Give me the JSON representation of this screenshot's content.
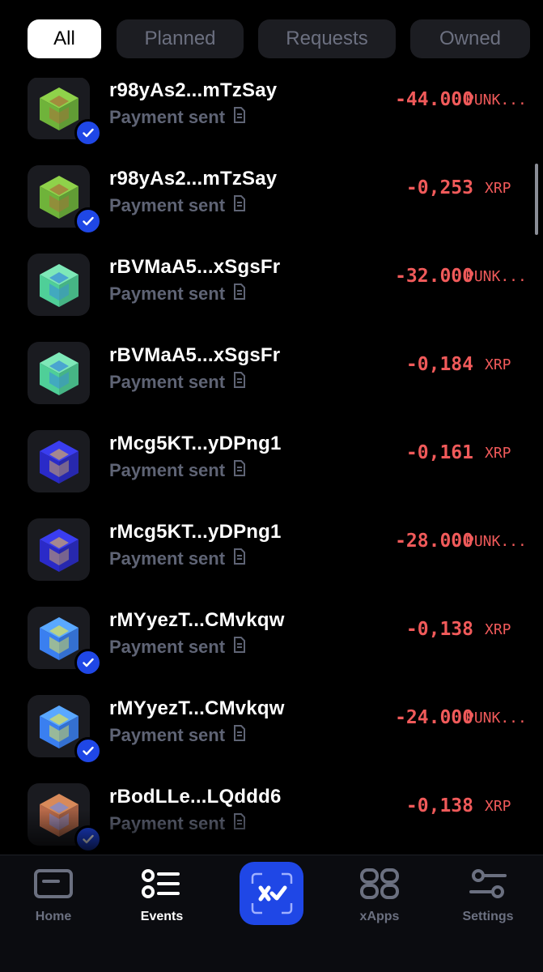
{
  "tabs": [
    {
      "label": "All",
      "active": true
    },
    {
      "label": "Planned",
      "active": false
    },
    {
      "label": "Requests",
      "active": false
    },
    {
      "label": "Owned",
      "active": false
    }
  ],
  "events": [
    {
      "address": "r98yAs2...mTzSay",
      "status": "Payment sent",
      "amount": "-44.000",
      "currency": "PUNK...",
      "verified": true,
      "avatar": "green-cube"
    },
    {
      "address": "r98yAs2...mTzSay",
      "status": "Payment sent",
      "amount": "-0,253",
      "currency": "XRP",
      "verified": true,
      "avatar": "green-cube"
    },
    {
      "address": "rBVMaA5...xSgsFr",
      "status": "Payment sent",
      "amount": "-32.000",
      "currency": "PUNK...",
      "verified": false,
      "avatar": "mint-cube"
    },
    {
      "address": "rBVMaA5...xSgsFr",
      "status": "Payment sent",
      "amount": "-0,184",
      "currency": "XRP",
      "verified": false,
      "avatar": "mint-cube"
    },
    {
      "address": "rMcg5KT...yDPng1",
      "status": "Payment sent",
      "amount": "-0,161",
      "currency": "XRP",
      "verified": false,
      "avatar": "indigo-cube"
    },
    {
      "address": "rMcg5KT...yDPng1",
      "status": "Payment sent",
      "amount": "-28.000",
      "currency": "PUNK...",
      "verified": false,
      "avatar": "indigo-cube"
    },
    {
      "address": "rMYyezT...CMvkqw",
      "status": "Payment sent",
      "amount": "-0,138",
      "currency": "XRP",
      "verified": true,
      "avatar": "blue-cube"
    },
    {
      "address": "rMYyezT...CMvkqw",
      "status": "Payment sent",
      "amount": "-24.000",
      "currency": "PUNK...",
      "verified": true,
      "avatar": "blue-cube"
    },
    {
      "address": "rBodLLe...LQddd6",
      "status": "Payment sent",
      "amount": "-0,138",
      "currency": "XRP",
      "verified": true,
      "avatar": "orange-cube"
    }
  ],
  "nav": {
    "home": "Home",
    "events": "Events",
    "xapps": "xApps",
    "settings": "Settings"
  },
  "colors": {
    "accent": "#1f47e6",
    "negative": "#f05a5a",
    "muted": "#5f6475"
  }
}
